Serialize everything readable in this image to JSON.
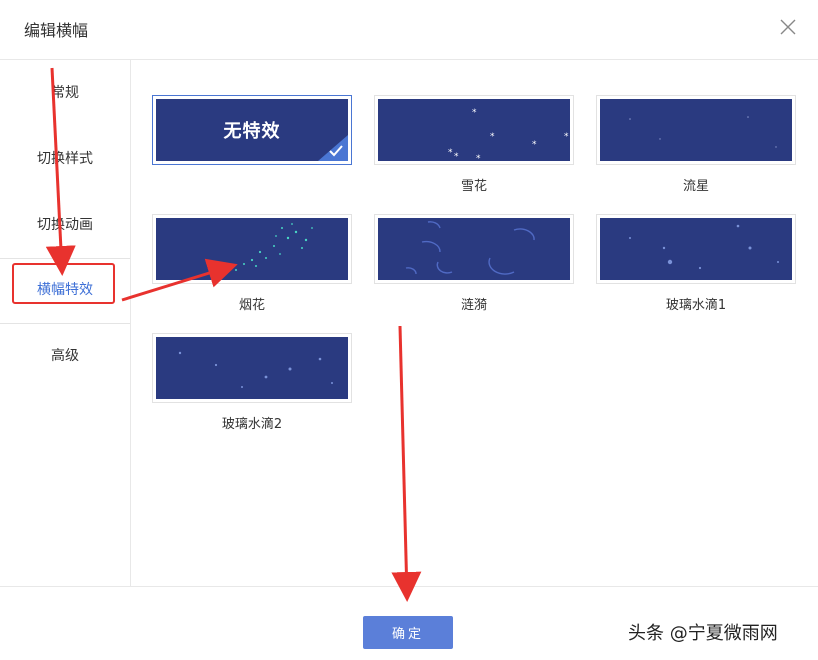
{
  "dialog": {
    "title": "编辑横幅"
  },
  "sidebar": {
    "items": [
      {
        "label": "常规"
      },
      {
        "label": "切换样式"
      },
      {
        "label": "切换动画"
      },
      {
        "label": "横幅特效"
      },
      {
        "label": "高级"
      }
    ],
    "active_index": 3
  },
  "effects": [
    {
      "label": "",
      "thumb_text": "无特效",
      "selected": true
    },
    {
      "label": "雪花"
    },
    {
      "label": "流星"
    },
    {
      "label": "烟花"
    },
    {
      "label": "涟漪"
    },
    {
      "label": "玻璃水滴1"
    },
    {
      "label": "玻璃水滴2"
    }
  ],
  "footer": {
    "confirm_label": "确定"
  },
  "watermark": "头条 @宁夏微雨网",
  "colors": {
    "accent": "#3d6fd6",
    "thumb_bg": "#2a3a80",
    "confirm_bg": "#5b7fd9",
    "annotation_red": "#e8322e"
  },
  "icons": {
    "close": "close-icon",
    "check": "check-icon"
  }
}
